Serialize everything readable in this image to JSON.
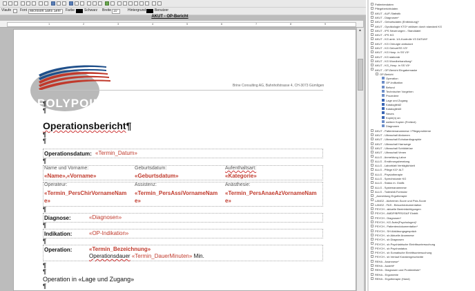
{
  "toolbar": {
    "paragraph_style": "Vlaufe",
    "font_label": "Font",
    "font_name": "Microsoft Sans Serif",
    "color_label": "Farbe",
    "color_name": "Schwarz",
    "hatching_label": "Hintergrund",
    "hatching_value": "Benutzer",
    "hint_label": "Breite",
    "hint_value": "10"
  },
  "document": {
    "tab_title": "AKUT - OP-Bericht",
    "company_line": "Brine Consulting AG, Bahnhofstrasse 4, CH-3073 Gümligen",
    "logo_text": "POLYPOINT",
    "pilcrow": "¶",
    "title": "Operationsbericht",
    "op_date_label": "Operationsdatum:",
    "op_date_field": "«Termin_Datum»",
    "name_header": "Name und Vorname:",
    "name_field": "«Name»,«Vorname»",
    "birth_header": "Geburtsdatum:",
    "birth_field": "«Geburtsdatum»",
    "stay_header": "Aufenthaltsart:",
    "stay_field": "«Kategorie»",
    "surgeon_header": "Operateur:",
    "surgeon_field": "«Termin_PersChirVornameName»",
    "assist_header": "Assistenz:",
    "assist_field": "«Termin_PersAssiVornameName»",
    "anesth_header": "Anästhesie:",
    "anesth_field": "«Termin_PersAnaeAzVornameName»",
    "diag_label": "Diagnose:",
    "diag_field": "«Diagnosen»",
    "ind_label": "Indikation:",
    "ind_field": "«OP-Indikation»",
    "op_label": "Operation:",
    "op_field": "«Termin_Bezeichnung»",
    "duration_prefix": "Operationsdauer",
    "duration_field": "«Termin_DauerMinuten»",
    "duration_suffix": "Min.",
    "position_line": "Operation in «Lage und Zugang»"
  },
  "tree": [
    {
      "label": "Patientendaten"
    },
    {
      "label": "Pflegeberichtdaten"
    },
    {
      "label": "AKUT - AUF-Statistik"
    },
    {
      "label": "AKUT - Diagnosen*"
    },
    {
      "label": "AKUT - Geburtsdaten (Entbindung)*"
    },
    {
      "label": "AKUT - Gynäkologie KTG* ablösen durch standard KG"
    },
    {
      "label": "AKUT - IPS Neuerungen - Standdatei"
    },
    {
      "label": "AKUT - IPS KG"
    },
    {
      "label": "AKUT - KG amb. 1/4-Kontrolle V3 DATUM*"
    },
    {
      "label": "AKUT - KG Chirurgie ambulant"
    },
    {
      "label": "AKUT - KG Geburt/SS V3*"
    },
    {
      "label": "AKUT - KG Hosp. in SS V3*"
    },
    {
      "label": "AKUT - KG stationär"
    },
    {
      "label": "AKUT - KG Wundbehandlung*"
    },
    {
      "label": "AKUT - KG_Hosp. in SS V3*"
    },
    {
      "label": "AKUT - OP-Bericht Eingabemaske"
    },
    {
      "label": "OP-Bericht"
    },
    {
      "label": "Operation"
    },
    {
      "label": "OP-Indikation"
    },
    {
      "label": "Befund"
    },
    {
      "label": "Technischer Vorgehen"
    },
    {
      "label": "Prozedere"
    },
    {
      "label": "Lage und Zugang"
    },
    {
      "label": "Katalogfeld2"
    },
    {
      "label": "Katalogfeld3"
    },
    {
      "label": "Neues"
    },
    {
      "label": "Kopie(n) an"
    },
    {
      "label": "weitere Kopien (Freitext)"
    },
    {
      "label": "Diagnosen"
    },
    {
      "label": "AKUT - Patientenanamnese / Pflegeprobleme"
    },
    {
      "label": "AKUT - Ultraschall Abdomen"
    },
    {
      "label": "AKUT - Ultraschall Echokardiographie"
    },
    {
      "label": "AKUT - Ultraschall Harnwege"
    },
    {
      "label": "AKUT - Ultraschall Schilddrüse"
    },
    {
      "label": "AKUT - Ultraschall Venen"
    },
    {
      "label": "ALLG - Anmeldung Labor"
    },
    {
      "label": "ALLG - Ernährungsberatung"
    },
    {
      "label": "ALLG - Laborblatt Verträglichkeit"
    },
    {
      "label": "ALLG - Pflege KG* ALT"
    },
    {
      "label": "ALLG - Physiotherapie"
    },
    {
      "label": "ALLG - Sprechstunde KG"
    },
    {
      "label": "ALLG - Status m. Grafik"
    },
    {
      "label": "ALLG - Systemanamnese"
    },
    {
      "label": "ALLG - Todesfall-Formular"
    },
    {
      "label": "_Anmeldung Ergotherapie"
    },
    {
      "label": "LANG2 - Alzheimer-Score und Pick-Score"
    },
    {
      "label": "LANG2 - FAS - Besuchdokumentation"
    },
    {
      "label": "PSYCH - aktuelle Beeinträchtigungen"
    },
    {
      "label": "PSYCH - AMDP/BPRS/GAF Eintritt"
    },
    {
      "label": "PSYCH - Diagnosen*"
    },
    {
      "label": "PSYCH - KG Ärzte(Psychologen)*"
    },
    {
      "label": "PSYCH - Patientendokumentation*"
    },
    {
      "label": "PSYCH - SH Abklärungsgespräch"
    },
    {
      "label": "PSYCH - sh Aktuelle Anamnese"
    },
    {
      "label": "PSYCH - sh Diagnosen"
    },
    {
      "label": "PSYCH - sh Psychiatrische Eintrittsuntersuchung"
    },
    {
      "label": "PSYCH - sh Psychostatus"
    },
    {
      "label": "PSYCH - sh Somatische Eintrittsuntersuchung"
    },
    {
      "label": "PSYCH - sh Verlauf Krankengeschichte"
    },
    {
      "label": "REHA - Anamnese*"
    },
    {
      "label": "REHA - Austritt*"
    },
    {
      "label": "REHA - Diagnosen und Problemliste*"
    },
    {
      "label": "REHA - Ergometrie"
    },
    {
      "label": "REHA - Ergotherapie (Hand)"
    }
  ]
}
